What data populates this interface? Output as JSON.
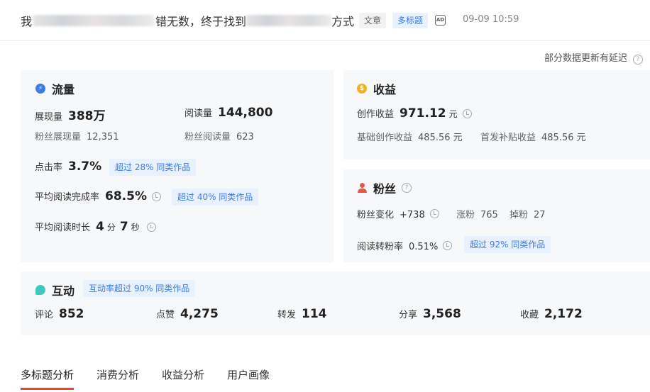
{
  "header": {
    "title_prefix": "我",
    "title_middle": "错无数，终于找到",
    "title_suffix": "方式",
    "tag_type": "文章",
    "tag_multi": "多标题",
    "ad_icon": "AD",
    "time": "09-09 10:59"
  },
  "delay_note": "部分数据更新有延迟",
  "traffic": {
    "title": "流量",
    "icon": "lightning-icon",
    "impressions_label": "展现量",
    "impressions_value": "388万",
    "reads_label": "阅读量",
    "reads_value": "144,800",
    "fan_impressions_label": "粉丝展现量",
    "fan_impressions_value": "12,351",
    "fan_reads_label": "粉丝阅读量",
    "fan_reads_value": "623",
    "ctr_label": "点击率",
    "ctr_value": "3.7%",
    "ctr_badge": "超过 28% 同类作品",
    "completion_label": "平均阅读完成率",
    "completion_value": "68.5%",
    "completion_badge": "超过 40% 同类作品",
    "duration_label": "平均阅读时长",
    "duration_min": "4",
    "duration_min_unit": "分",
    "duration_sec": "7",
    "duration_sec_unit": "秒"
  },
  "revenue": {
    "title": "收益",
    "icon": "coin-icon",
    "creation_label": "创作收益",
    "creation_value": "971.12",
    "creation_unit": "元",
    "base_label": "基础创作收益",
    "base_value": "485.56 元",
    "first_label": "首发补贴收益",
    "first_value": "485.56 元"
  },
  "fans": {
    "title": "粉丝",
    "icon": "user-icon",
    "change_label": "粉丝变化",
    "change_value": "+738",
    "gain_label": "涨粉",
    "gain_value": "765",
    "loss_label": "掉粉",
    "loss_value": "27",
    "conv_label": "阅读转粉率",
    "conv_value": "0.51%",
    "conv_badge": "超过 92% 同类作品"
  },
  "interaction": {
    "title": "互动",
    "icon": "chat-bubble-icon",
    "badge": "互动率超过 90% 同类作品",
    "items": [
      {
        "label": "评论",
        "value": "852"
      },
      {
        "label": "点赞",
        "value": "4,275"
      },
      {
        "label": "转发",
        "value": "114"
      },
      {
        "label": "分享",
        "value": "3,568"
      },
      {
        "label": "收藏",
        "value": "2,172"
      }
    ]
  },
  "tabs": [
    {
      "label": "多标题分析",
      "active": true
    },
    {
      "label": "消费分析",
      "active": false
    },
    {
      "label": "收益分析",
      "active": false
    },
    {
      "label": "用户画像",
      "active": false
    }
  ],
  "colors": {
    "accent": "#3d7be6",
    "tab_underline": "#e8452f",
    "card_bg": "#f7f8fa"
  }
}
